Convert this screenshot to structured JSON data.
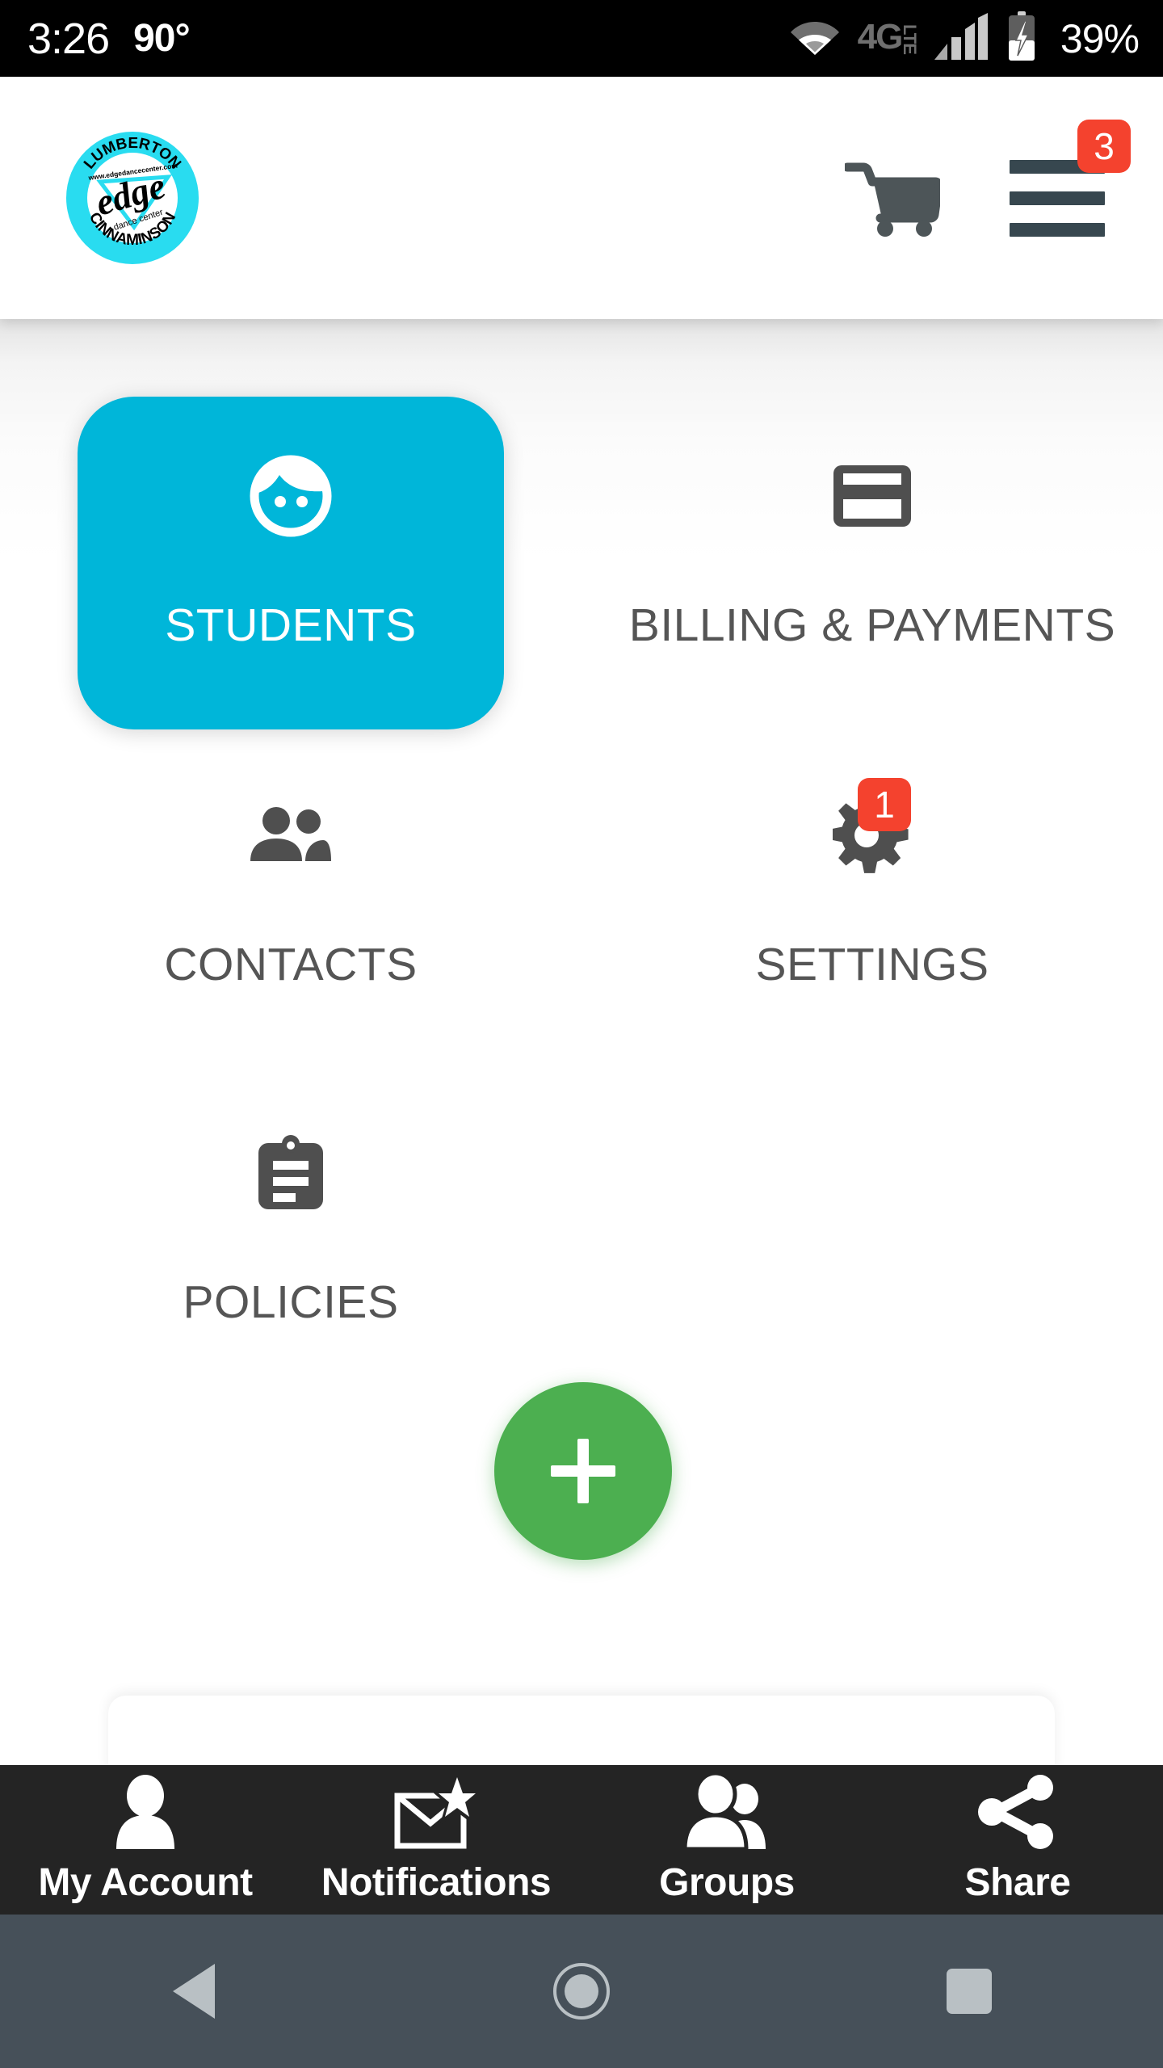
{
  "status_bar": {
    "time": "3:26",
    "temperature": "90°",
    "network_type": "4G",
    "network_sub": "LTE",
    "battery_percent": "39%",
    "icons": [
      "wifi-icon",
      "signal-bars-icon",
      "battery-charging-icon"
    ],
    "background_color": "#000000",
    "text_color": "#ffffff"
  },
  "app_bar": {
    "logo": {
      "name": "edge-dance-center-logo",
      "top_text": "LUMBERTON",
      "bottom_text": "CINNAMINSON",
      "brand": "edge",
      "tagline": "dance center",
      "website": "www.edgedancecenter.com",
      "accent_color": "#29dcf0"
    },
    "cart_icon_label": "shopping-cart-icon",
    "menu_icon_label": "hamburger-menu-icon",
    "menu_badge": "3",
    "badge_color": "#f4422e"
  },
  "dashboard": {
    "tiles": [
      {
        "label": "STUDENTS",
        "icon": "child-face-icon",
        "active": true,
        "badge": null
      },
      {
        "label": "BILLING & PAYMENTS",
        "icon": "credit-card-icon",
        "active": false,
        "badge": null
      },
      {
        "label": "CONTACTS",
        "icon": "contacts-icon",
        "active": false,
        "badge": null
      },
      {
        "label": "SETTINGS",
        "icon": "gear-icon",
        "active": false,
        "badge": "1"
      },
      {
        "label": "POLICIES",
        "icon": "clipboard-icon",
        "active": false,
        "badge": null
      }
    ],
    "active_tile_color": "#00b6d9",
    "tile_label_color": "#555555",
    "add_button": {
      "name": "add-button",
      "icon": "plus-icon",
      "color": "#4caf50"
    }
  },
  "bottom_nav": {
    "items": [
      {
        "label": "My Account",
        "icon": "person-icon"
      },
      {
        "label": "Notifications",
        "icon": "mail-star-icon"
      },
      {
        "label": "Groups",
        "icon": "people-group-icon"
      },
      {
        "label": "Share",
        "icon": "share-icon"
      }
    ],
    "background_color": "#242424"
  },
  "system_nav": {
    "back": "back-triangle-icon",
    "home": "home-circle-icon",
    "recents": "recents-square-icon",
    "background_color": "#465059"
  }
}
